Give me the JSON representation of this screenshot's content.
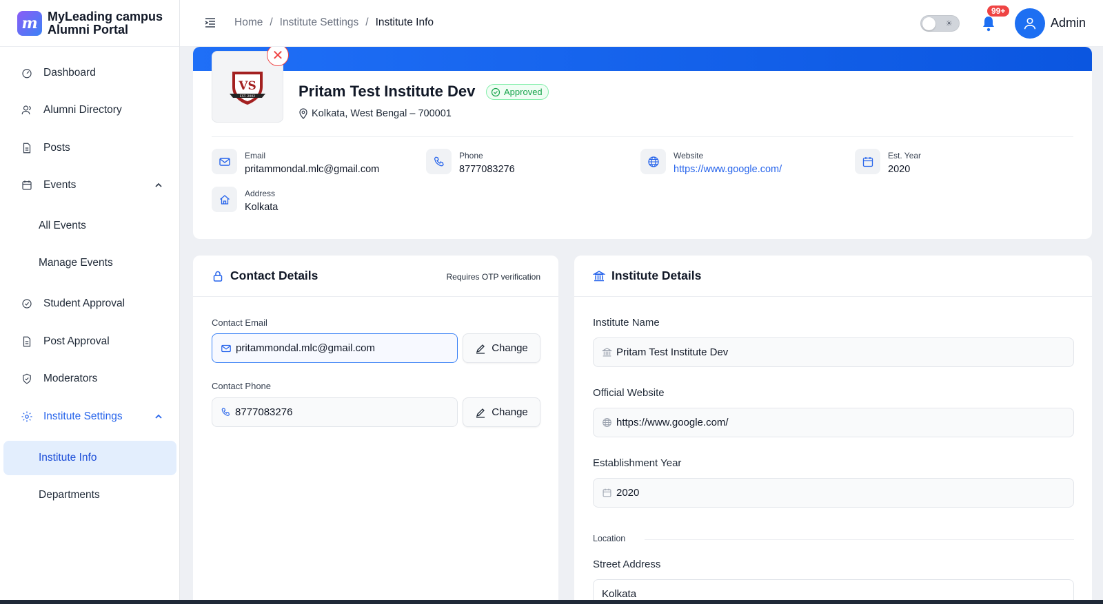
{
  "brand": {
    "logo_letter": "m",
    "line1": "MyLeading campus",
    "line2": "Alumni Portal",
    "accent": "#2563eb"
  },
  "sidebar": {
    "items": [
      {
        "label": "Dashboard",
        "icon": "gauge-icon"
      },
      {
        "label": "Alumni Directory",
        "icon": "users-icon"
      },
      {
        "label": "Posts",
        "icon": "document-icon"
      },
      {
        "label": "Events",
        "icon": "calendar-icon",
        "expanded": true
      },
      {
        "label": "Student Approval",
        "icon": "check-circle-icon"
      },
      {
        "label": "Post Approval",
        "icon": "document-icon"
      },
      {
        "label": "Moderators",
        "icon": "shield-icon"
      },
      {
        "label": "Institute Settings",
        "icon": "gear-icon",
        "expanded": true,
        "active": true
      }
    ],
    "events_sub": [
      "All Events",
      "Manage Events"
    ],
    "settings_sub": [
      "Institute Info",
      "Departments"
    ],
    "active_sub": "Institute Info"
  },
  "topbar": {
    "breadcrumb": [
      "Home",
      "Institute Settings",
      "Institute Info"
    ],
    "separator": "/",
    "notification_count": "99+",
    "user": "Admin",
    "theme": "light"
  },
  "profile": {
    "logo_text": "EST. 2002",
    "logo_monogram": "VS",
    "name": "Pritam Test Institute Dev",
    "status": "Approved",
    "location": "Kolkata, West Bengal – 700001",
    "email_label": "Email",
    "email": "pritammondal.mlc@gmail.com",
    "phone_label": "Phone",
    "phone": "8777083276",
    "website_label": "Website",
    "website": "https://www.google.com/",
    "year_label": "Est. Year",
    "year": "2020",
    "address_label": "Address",
    "address": "Kolkata"
  },
  "contact": {
    "title": "Contact Details",
    "note": "Requires OTP verification",
    "email_label": "Contact Email",
    "email_value": "pritammondal.mlc@gmail.com",
    "phone_label": "Contact Phone",
    "phone_value": "8777083276",
    "change_label": "Change"
  },
  "institute": {
    "title": "Institute Details",
    "name_label": "Institute Name",
    "name_value": "Pritam Test Institute Dev",
    "website_label": "Official Website",
    "website_value": "https://www.google.com/",
    "year_label": "Establishment Year",
    "year_value": "2020",
    "location_heading": "Location",
    "street_label": "Street Address",
    "street_value": "Kolkata"
  }
}
